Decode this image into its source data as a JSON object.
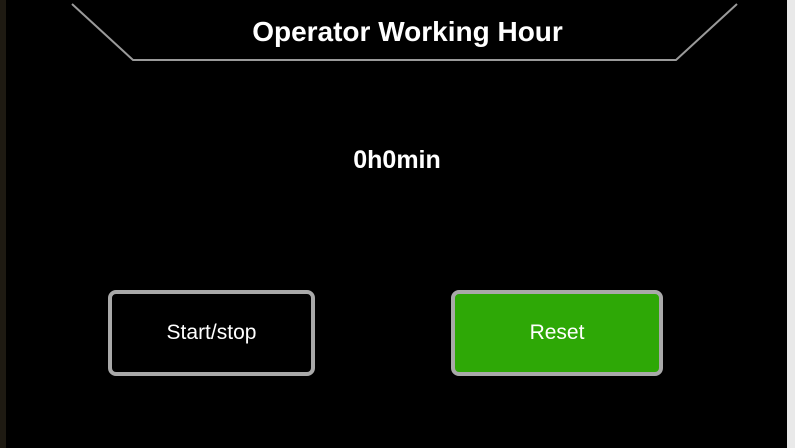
{
  "header": {
    "title": "Operator Working Hour"
  },
  "timer": {
    "value": "0h0min"
  },
  "buttons": {
    "start_stop_label": "Start/stop",
    "reset_label": "Reset"
  },
  "colors": {
    "background": "#000000",
    "text": "#ffffff",
    "reset_button": "#2ea806",
    "button_border": "#a9a9a9"
  }
}
